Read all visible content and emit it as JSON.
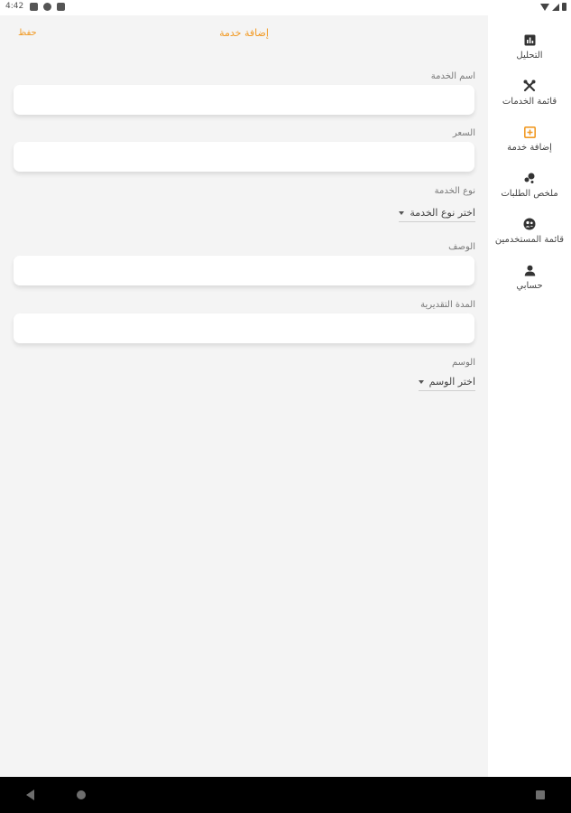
{
  "status_bar": {
    "time": "4:42"
  },
  "header": {
    "save_label": "حفظ",
    "title": "إضافة خدمة"
  },
  "form": {
    "service_name_label": "اسم الخدمة",
    "service_name_value": "",
    "price_label": "السعر",
    "price_value": "",
    "service_type_label": "نوع الخدمة",
    "service_type_selected": "اختر نوع الخدمة",
    "description_label": "الوصف",
    "description_value": "",
    "duration_label": "المدة التقديرية",
    "duration_value": "",
    "tag_label": "الوسم",
    "tag_selected": "اختر الوسم"
  },
  "sidebar": {
    "items": [
      {
        "label": "التحليل",
        "icon": "analytics-icon"
      },
      {
        "label": "قائمة الخدمات",
        "icon": "tools-icon"
      },
      {
        "label": "إضافة خدمة",
        "icon": "add-box-icon",
        "active": true
      },
      {
        "label": "ملخص الطلبات",
        "icon": "bubbles-icon"
      },
      {
        "label": "قائمة المستخدمين",
        "icon": "users-icon"
      },
      {
        "label": "حسابي",
        "icon": "person-icon"
      }
    ]
  },
  "colors": {
    "accent": "#f19a25",
    "background": "#f4f4f4",
    "sidebar": "#ffffff"
  }
}
